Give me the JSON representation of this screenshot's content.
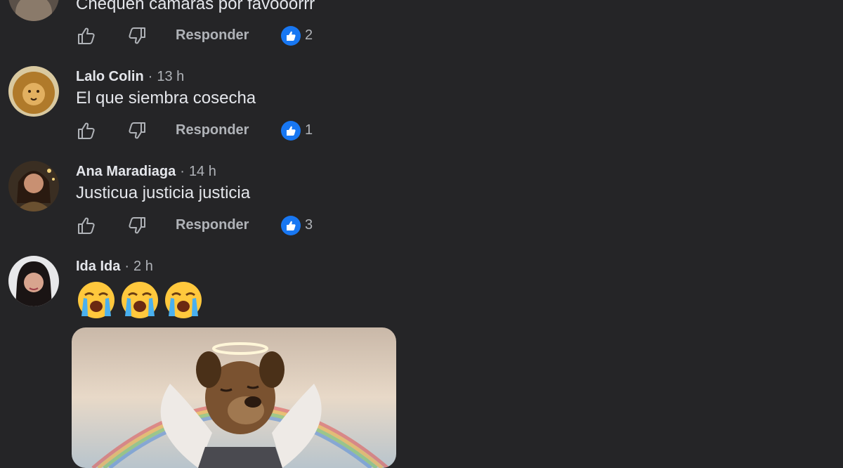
{
  "comments": [
    {
      "author": "",
      "time": "",
      "text": "Chequen cámaras por favooorrr",
      "reply_label": "Responder",
      "like_count": "2"
    },
    {
      "author": "Lalo Colin",
      "time": "13 h",
      "text": "El que siembra cosecha",
      "reply_label": "Responder",
      "like_count": "1"
    },
    {
      "author": "Ana Maradiaga",
      "time": "14 h",
      "text": "Justicua justicia justicia",
      "reply_label": "Responder",
      "like_count": "3"
    },
    {
      "author": "Ida Ida",
      "time": "2 h",
      "emojis": [
        "loudly-crying-face",
        "loudly-crying-face",
        "loudly-crying-face"
      ],
      "photo": "angel-dog-with-halo-and-wings"
    }
  ],
  "separator": "·",
  "colors": {
    "background": "#252527",
    "text_primary": "#e4e6eb",
    "text_secondary": "#b0b3b8",
    "like_blue": "#1877f2"
  },
  "icons": {
    "like": "thumbs-up-outline-icon",
    "dislike": "thumbs-down-outline-icon",
    "reaction": "like-reaction-icon"
  }
}
